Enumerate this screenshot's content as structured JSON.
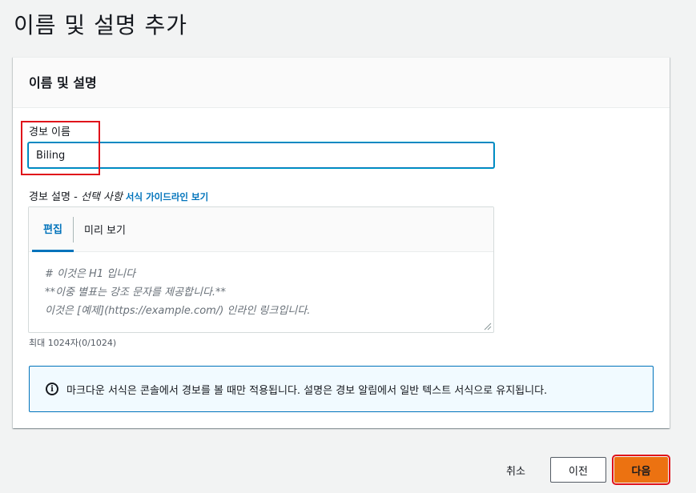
{
  "page": {
    "title": "이름 및 설명 추가"
  },
  "section": {
    "title": "이름 및 설명"
  },
  "alarm_name": {
    "label": "경보 이름",
    "value": "Biling"
  },
  "alarm_description": {
    "label": "경보 설명 - ",
    "optional": "선택 사항",
    "guide_link": "서식 가이드라인 보기",
    "tabs": [
      {
        "label": "편집",
        "active": true
      },
      {
        "label": "미리 보기",
        "active": false
      }
    ],
    "placeholder_lines": [
      "# 이것은 H1 입니다",
      "**이중 별표는 강조 문자를 제공합니다.**",
      "이것은 [예제](https://example.com/) 인라인 링크입니다."
    ],
    "char_count": "최대 1024자(0/1024)"
  },
  "info": {
    "icon": "info-icon",
    "text": "마크다운 서식은 콘솔에서 경보를 볼 때만 적용됩니다. 설명은 경보 알림에서 일반 텍스트 서식으로 유지됩니다."
  },
  "footer": {
    "cancel": "취소",
    "previous": "이전",
    "next": "다음"
  },
  "colors": {
    "accent": "#0073bb",
    "primary_button": "#ec7211",
    "highlight": "#e0121a"
  }
}
